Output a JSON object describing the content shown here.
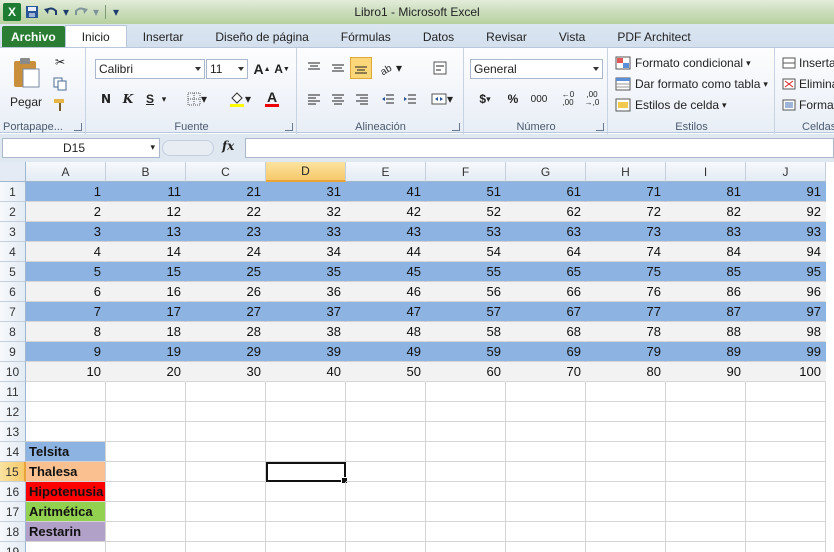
{
  "window": {
    "title": "Libro1 - Microsoft Excel"
  },
  "quick_access": {
    "icons": [
      "excel-logo-icon",
      "save-icon",
      "undo-icon",
      "redo-icon",
      "customize-icon"
    ],
    "logo_letter": "X"
  },
  "tabs": [
    {
      "label": "Archivo"
    },
    {
      "label": "Inicio"
    },
    {
      "label": "Insertar"
    },
    {
      "label": "Diseño de página"
    },
    {
      "label": "Fórmulas"
    },
    {
      "label": "Datos"
    },
    {
      "label": "Revisar"
    },
    {
      "label": "Vista"
    },
    {
      "label": "PDF Architect"
    }
  ],
  "ribbon": {
    "clipboard": {
      "label": "Portapape...",
      "paste": "Pegar"
    },
    "font": {
      "label": "Fuente",
      "name": "Calibri",
      "size": "11",
      "bold": "N",
      "italic": "K",
      "underline": "S",
      "grow": "A",
      "shrink": "A"
    },
    "alignment": {
      "label": "Alineación"
    },
    "number": {
      "label": "Número",
      "format": "General",
      "currency": "$",
      "percent": "%",
      "thousands": "000",
      "dec_inc": "←0 ,00",
      "dec_dec": ",00 →,0"
    },
    "styles": {
      "label": "Estilos",
      "conditional": "Formato condicional",
      "table": "Dar formato como tabla",
      "cell_styles": "Estilos de celda"
    },
    "cells": {
      "label": "Celdas",
      "insert": "Insertar",
      "delete": "Eliminar",
      "format": "Formato"
    }
  },
  "formula_bar": {
    "name_box": "D15",
    "fx": "fx",
    "value": ""
  },
  "grid": {
    "columns": [
      "A",
      "B",
      "C",
      "D",
      "E",
      "F",
      "G",
      "H",
      "I",
      "J"
    ],
    "selected_column": "D",
    "selected_row": 15,
    "row_numbers": [
      1,
      2,
      3,
      4,
      5,
      6,
      7,
      8,
      9,
      10,
      11,
      12,
      13,
      14,
      15,
      16,
      17,
      18,
      19
    ],
    "odd_row_fill": "#8db3e2",
    "even_row_fill": "#f2f2f2",
    "number_rows": [
      [
        "1",
        "11",
        "21",
        "31",
        "41",
        "51",
        "61",
        "71",
        "81",
        "91"
      ],
      [
        "2",
        "12",
        "22",
        "32",
        "42",
        "52",
        "62",
        "72",
        "82",
        "92"
      ],
      [
        "3",
        "13",
        "23",
        "33",
        "43",
        "53",
        "63",
        "73",
        "83",
        "93"
      ],
      [
        "4",
        "14",
        "24",
        "34",
        "44",
        "54",
        "64",
        "74",
        "84",
        "94"
      ],
      [
        "5",
        "15",
        "25",
        "35",
        "45",
        "55",
        "65",
        "75",
        "85",
        "95"
      ],
      [
        "6",
        "16",
        "26",
        "36",
        "46",
        "56",
        "66",
        "76",
        "86",
        "96"
      ],
      [
        "7",
        "17",
        "27",
        "37",
        "47",
        "57",
        "67",
        "77",
        "87",
        "97"
      ],
      [
        "8",
        "18",
        "28",
        "38",
        "48",
        "58",
        "68",
        "78",
        "88",
        "98"
      ],
      [
        "9",
        "19",
        "29",
        "39",
        "49",
        "59",
        "69",
        "79",
        "89",
        "99"
      ],
      [
        "10",
        "20",
        "30",
        "40",
        "50",
        "60",
        "70",
        "80",
        "90",
        "100"
      ]
    ],
    "labels": [
      {
        "row": 14,
        "text": "Telsita",
        "fill": "#8db3e2"
      },
      {
        "row": 15,
        "text": "Thalesa",
        "fill": "#fac090"
      },
      {
        "row": 16,
        "text": "Hipotenusia",
        "fill": "#ff0000"
      },
      {
        "row": 17,
        "text": "Aritmética",
        "fill": "#92d050"
      },
      {
        "row": 18,
        "text": "Restarin",
        "fill": "#b1a0c7"
      }
    ]
  }
}
